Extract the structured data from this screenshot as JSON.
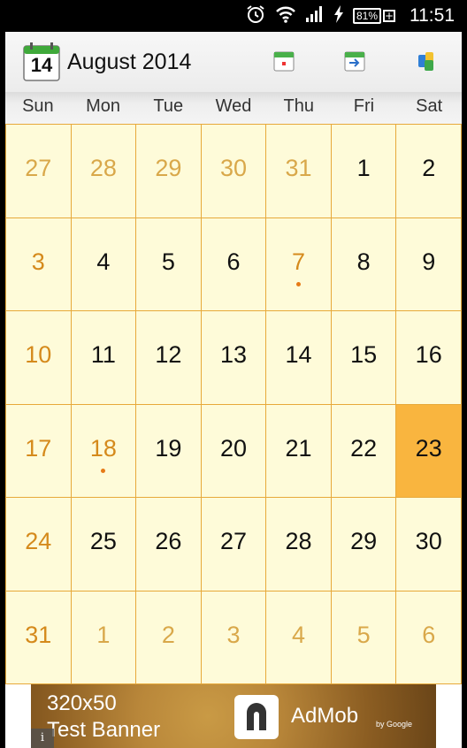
{
  "status_bar": {
    "battery": "81%",
    "battery_extra": "+",
    "time": "11:51"
  },
  "header": {
    "title": "August 2014",
    "app_icon_day": "14",
    "buttons": [
      "today-calendar-icon",
      "goto-date-icon",
      "settings-icon"
    ]
  },
  "weekdays": [
    "Sun",
    "Mon",
    "Tue",
    "Wed",
    "Thu",
    "Fri",
    "Sat"
  ],
  "weeks": [
    [
      {
        "d": "27",
        "t": "other"
      },
      {
        "d": "28",
        "t": "other"
      },
      {
        "d": "29",
        "t": "other"
      },
      {
        "d": "30",
        "t": "other"
      },
      {
        "d": "31",
        "t": "other"
      },
      {
        "d": "1",
        "t": "cur"
      },
      {
        "d": "2",
        "t": "cur"
      }
    ],
    [
      {
        "d": "3",
        "t": "sun"
      },
      {
        "d": "4",
        "t": "cur"
      },
      {
        "d": "5",
        "t": "cur"
      },
      {
        "d": "6",
        "t": "cur"
      },
      {
        "d": "7",
        "t": "sun",
        "event": true
      },
      {
        "d": "8",
        "t": "cur"
      },
      {
        "d": "9",
        "t": "cur"
      }
    ],
    [
      {
        "d": "10",
        "t": "sun"
      },
      {
        "d": "11",
        "t": "cur"
      },
      {
        "d": "12",
        "t": "cur"
      },
      {
        "d": "13",
        "t": "cur"
      },
      {
        "d": "14",
        "t": "cur"
      },
      {
        "d": "15",
        "t": "cur"
      },
      {
        "d": "16",
        "t": "cur"
      }
    ],
    [
      {
        "d": "17",
        "t": "sun"
      },
      {
        "d": "18",
        "t": "sun",
        "event": true
      },
      {
        "d": "19",
        "t": "cur"
      },
      {
        "d": "20",
        "t": "cur"
      },
      {
        "d": "21",
        "t": "cur"
      },
      {
        "d": "22",
        "t": "cur"
      },
      {
        "d": "23",
        "t": "cur",
        "selected": true
      }
    ],
    [
      {
        "d": "24",
        "t": "sun"
      },
      {
        "d": "25",
        "t": "cur"
      },
      {
        "d": "26",
        "t": "cur"
      },
      {
        "d": "27",
        "t": "cur"
      },
      {
        "d": "28",
        "t": "cur"
      },
      {
        "d": "29",
        "t": "cur"
      },
      {
        "d": "30",
        "t": "cur"
      }
    ],
    [
      {
        "d": "31",
        "t": "sun"
      },
      {
        "d": "1",
        "t": "other"
      },
      {
        "d": "2",
        "t": "other"
      },
      {
        "d": "3",
        "t": "other"
      },
      {
        "d": "4",
        "t": "other"
      },
      {
        "d": "5",
        "t": "other"
      },
      {
        "d": "6",
        "t": "other"
      }
    ]
  ],
  "ad": {
    "line1": "320x50",
    "line2": "Test Banner",
    "brand": "AdMob",
    "by": "by Google",
    "info": "i"
  },
  "colors": {
    "grid_line": "#e7a93a",
    "cell_bg": "#fefbd9",
    "selected_bg": "#f9b53f",
    "holiday_text": "#d58a1c",
    "other_month_text": "#d9a84a",
    "event_dot": "#e67a17"
  }
}
